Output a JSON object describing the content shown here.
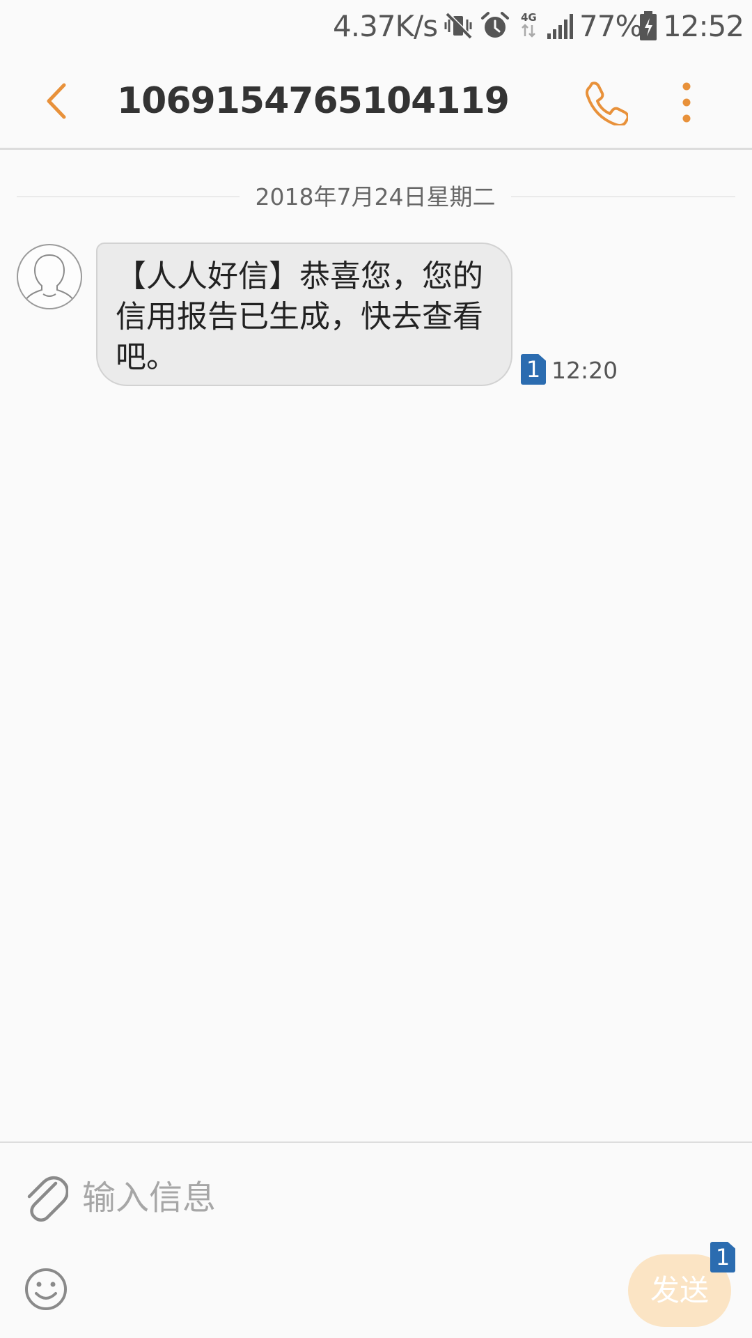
{
  "status_bar": {
    "network_speed": "4.37K/s",
    "network_type": "4G",
    "battery_percent": "77%",
    "time": "12:52",
    "icons": [
      "vibrate-mute-icon",
      "alarm-icon",
      "4g-data-icon",
      "signal-icon",
      "battery-icon"
    ]
  },
  "header": {
    "title": "1069154765104119",
    "icons": [
      "back-icon",
      "phone-icon",
      "more-vert-icon"
    ]
  },
  "conversation": {
    "date_divider": "2018年7月24日星期二",
    "messages": [
      {
        "direction": "incoming",
        "text": "【人人好信】恭喜您，您的信用报告已生成，快去查看吧。",
        "sim": "1",
        "time": "12:20"
      }
    ]
  },
  "composer": {
    "placeholder": "输入信息",
    "send_label": "发送",
    "send_sim": "1",
    "icons": [
      "paperclip-icon",
      "emoji-icon"
    ]
  },
  "colors": {
    "accent": "#e8913a",
    "bubble": "#ebebeb",
    "sim_badge": "#2b6cb0",
    "send_disabled": "#fbe4c4"
  }
}
